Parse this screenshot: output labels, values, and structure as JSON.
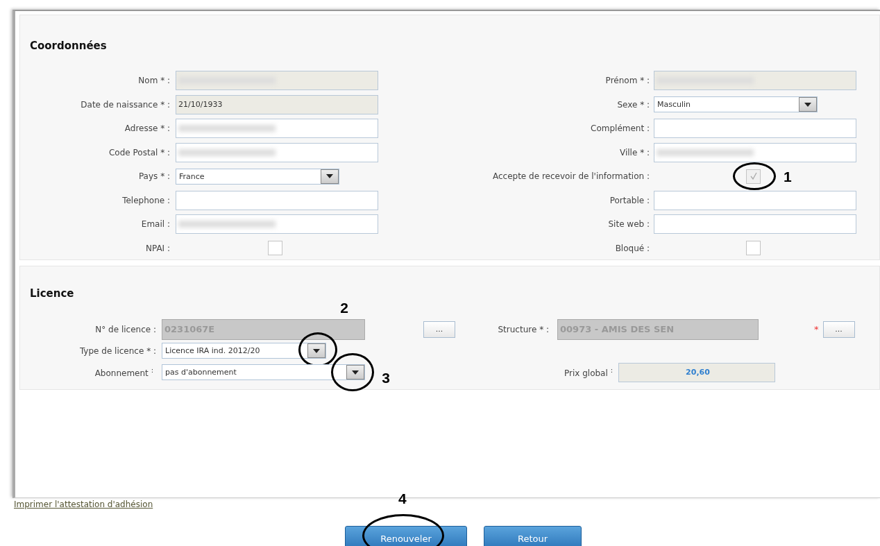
{
  "coordonnees": {
    "title": "Coordonnées",
    "left": [
      {
        "label": "Nom * :",
        "kind": "text",
        "readonly": true,
        "blurred": true
      },
      {
        "label": "Date de naissance * :",
        "kind": "text",
        "readonly": true,
        "value": "21/10/1933"
      },
      {
        "label": "Adresse * :",
        "kind": "text",
        "readonly": false,
        "blurred": true
      },
      {
        "label": "Code Postal * :",
        "kind": "text",
        "readonly": false,
        "blurred": true
      },
      {
        "label": "Pays * :",
        "kind": "select",
        "value": "France"
      },
      {
        "label": "Telephone :",
        "kind": "text",
        "readonly": false
      },
      {
        "label": "Email :",
        "kind": "text",
        "readonly": false,
        "blurred": true
      },
      {
        "label": "NPAI :",
        "kind": "checkbox",
        "checked": false,
        "disabled": false
      }
    ],
    "right": [
      {
        "label": "Prénom * :",
        "kind": "text",
        "readonly": true,
        "blurred": true
      },
      {
        "label": "Sexe * :",
        "kind": "select",
        "value": "Masculin"
      },
      {
        "label": "Complément :",
        "kind": "text",
        "readonly": false
      },
      {
        "label": "Ville * :",
        "kind": "text",
        "readonly": false,
        "blurred": true
      },
      {
        "label": "Accepte de recevoir de l'information :",
        "kind": "checkbox",
        "checked": true,
        "disabled": true,
        "callout": "1"
      },
      {
        "label": "Portable :",
        "kind": "text",
        "readonly": false
      },
      {
        "label": "Site web :",
        "kind": "text",
        "readonly": false
      },
      {
        "label": "Bloqué :",
        "kind": "checkbox",
        "checked": false,
        "disabled": false
      }
    ]
  },
  "licence": {
    "title": "Licence",
    "number": {
      "label": "N° de licence :",
      "value": "0231067E",
      "button": "..."
    },
    "structure": {
      "label": "Structure * :",
      "value": "00973 - AMIS DES SEN",
      "required_mark": "*",
      "button": "..."
    },
    "type": {
      "label": "Type de licence * :",
      "value": "Licence IRA ind. 2012/20",
      "callout": "2"
    },
    "subscription": {
      "label": "Abonnement $^{:}$",
      "value": "pas d'abonnement",
      "callout": "3"
    },
    "price": {
      "label": "Prix global $^{:}$",
      "value": "20,60"
    }
  },
  "print_link": "Imprimer l'attestation d'adhésion",
  "buttons": [
    {
      "label": "Renouveler",
      "callout": "4"
    },
    {
      "label": "Retour"
    }
  ]
}
